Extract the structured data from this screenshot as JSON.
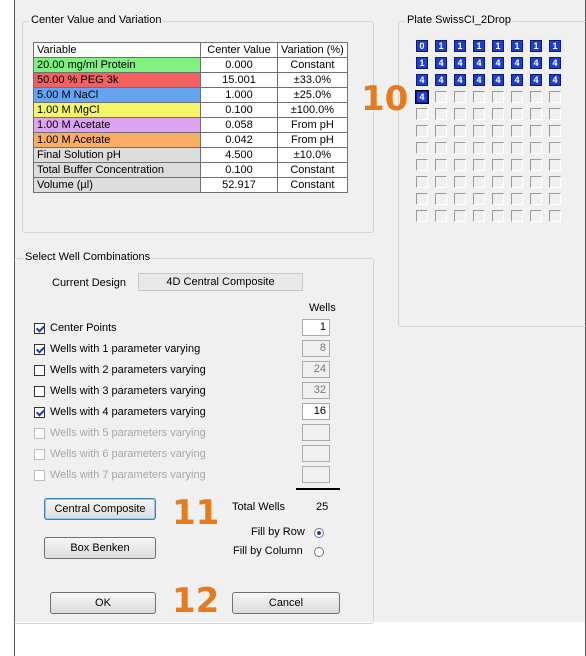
{
  "center_group": {
    "title": "Center Value and Variation",
    "headers": [
      "Variable",
      "Center Value",
      "Variation (%)"
    ],
    "rows": [
      {
        "variable": "20.00 mg/ml Protein",
        "center": "0.000",
        "variation": "Constant",
        "color": "#80f080"
      },
      {
        "variable": "50.00 % PEG 3k",
        "center": "15.001",
        "variation": "±33.0%",
        "color": "#f26060"
      },
      {
        "variable": "5.00 M NaCl",
        "center": "1.000",
        "variation": "±25.0%",
        "color": "#64a4f0"
      },
      {
        "variable": "1.00 M MgCl",
        "center": "0.100",
        "variation": "±100.0%",
        "color": "#f5f56a"
      },
      {
        "variable": "1.00 M Acetate",
        "center": "0.058",
        "variation": "From pH",
        "color": "#dca4f2"
      },
      {
        "variable": "1.00 M Acetate",
        "center": "0.042",
        "variation": "From pH",
        "color": "#f8ac64"
      },
      {
        "variable": "Final Solution pH",
        "center": "4.500",
        "variation": "±10.0%",
        "color": "#dcdcdc"
      },
      {
        "variable": "Total Buffer Concentration",
        "center": "0.100",
        "variation": "Constant",
        "color": "#dcdcdc"
      },
      {
        "variable": "Volume (µl)",
        "center": "52.917",
        "variation": "Constant",
        "color": "#dcdcdc"
      }
    ]
  },
  "plate": {
    "title": "Plate SwissCI_2Drop",
    "rows": [
      [
        "0",
        "1",
        "1",
        "1",
        "1",
        "1",
        "1",
        "1"
      ],
      [
        "1",
        "4",
        "4",
        "4",
        "4",
        "4",
        "4",
        "4"
      ],
      [
        "4",
        "4",
        "4",
        "4",
        "4",
        "4",
        "4",
        "4"
      ],
      [
        "4",
        "",
        "",
        "",
        "",
        "",
        "",
        ""
      ],
      [
        "",
        "",
        "",
        "",
        "",
        "",
        "",
        ""
      ],
      [
        "",
        "",
        "",
        "",
        "",
        "",
        "",
        ""
      ],
      [
        "",
        "",
        "",
        "",
        "",
        "",
        "",
        ""
      ],
      [
        "",
        "",
        "",
        "",
        "",
        "",
        "",
        ""
      ],
      [
        "",
        "",
        "",
        "",
        "",
        "",
        "",
        ""
      ],
      [
        "",
        "",
        "",
        "",
        "",
        "",
        "",
        ""
      ],
      [
        "",
        "",
        "",
        "",
        "",
        "",
        "",
        ""
      ]
    ]
  },
  "callouts": {
    "ten": "10",
    "eleven": "11",
    "twelve": "12"
  },
  "well_group": {
    "title": "Select Well Combinations",
    "design_label": "Current Design",
    "design_value": "4D Central Composite",
    "wells_header": "Wells",
    "options": [
      {
        "label": "Center Points",
        "checked": true,
        "enabled": true,
        "count": "1",
        "count_editable": true
      },
      {
        "label": "Wells with 1 parameter varying",
        "checked": true,
        "enabled": true,
        "count": "8",
        "count_editable": false
      },
      {
        "label": "Wells with 2 parameters varying",
        "checked": false,
        "enabled": true,
        "count": "24",
        "count_editable": false
      },
      {
        "label": "Wells with 3 parameters varying",
        "checked": false,
        "enabled": true,
        "count": "32",
        "count_editable": false
      },
      {
        "label": "Wells with 4 parameters varying",
        "checked": true,
        "enabled": true,
        "count": "16",
        "count_editable": true
      },
      {
        "label": "Wells with 5 parameters varying",
        "checked": false,
        "enabled": false,
        "count": "",
        "count_editable": false
      },
      {
        "label": "Wells with 6 parameters varying",
        "checked": false,
        "enabled": false,
        "count": "",
        "count_editable": false
      },
      {
        "label": "Wells with 7 parameters varying",
        "checked": false,
        "enabled": false,
        "count": "",
        "count_editable": false
      }
    ],
    "central_composite_label": "Central Composite",
    "box_benken_label": "Box Benken",
    "total_wells_label": "Total Wells",
    "total_wells_value": "25",
    "fill_by_row_label": "Fill by Row",
    "fill_by_column_label": "Fill by Column",
    "fill_mode": "row",
    "ok_label": "OK",
    "cancel_label": "Cancel"
  }
}
